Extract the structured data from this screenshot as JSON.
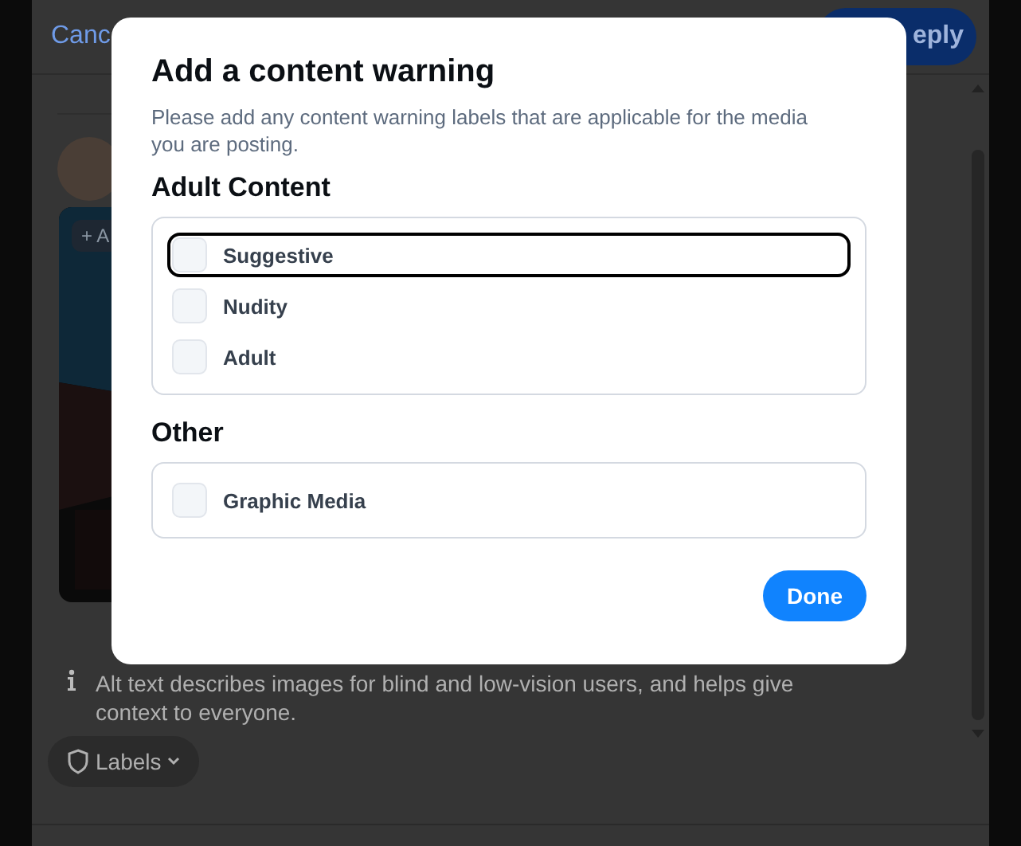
{
  "background": {
    "cancel": "Canc",
    "reply": "eply",
    "image_chip": "+ A",
    "alt_text_info": "Alt text describes images for blind and low-vision users, and helps give context to everyone.",
    "labels_button": "Labels"
  },
  "dialog": {
    "title": "Add a content warning",
    "description": "Please add any content warning labels that are applicable for the media you are posting.",
    "sections": [
      {
        "heading": "Adult Content",
        "options": [
          {
            "label": "Suggestive",
            "checked": false,
            "focused": true
          },
          {
            "label": "Nudity",
            "checked": false,
            "focused": false
          },
          {
            "label": "Adult",
            "checked": false,
            "focused": false
          }
        ]
      },
      {
        "heading": "Other",
        "options": [
          {
            "label": "Graphic Media",
            "checked": false,
            "focused": false
          }
        ]
      }
    ],
    "done_button": "Done"
  }
}
